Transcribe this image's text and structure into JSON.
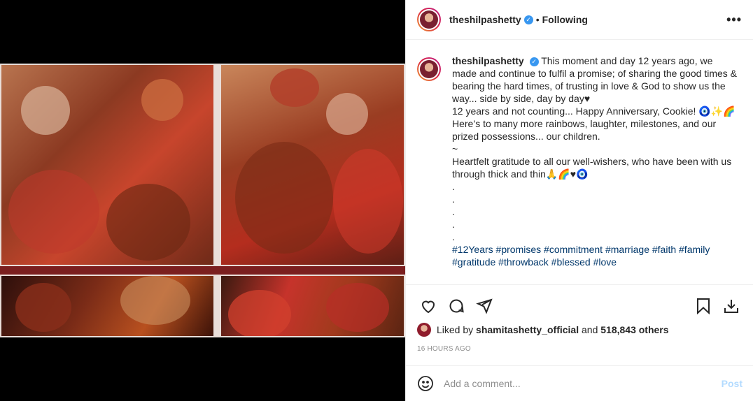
{
  "header": {
    "username": "theshilpashetty",
    "separator": "•",
    "follow_status": "Following",
    "more_label": "•••",
    "verified_mark": "✓"
  },
  "caption": {
    "username": "theshilpashetty",
    "lines": [
      "This moment and day 12 years ago, we made and continue to fulfil a promise; of sharing the good times & bearing the hard times, of trusting in love & God to show us the way... side by side, day by day♥",
      "12 years and not counting... Happy Anniversary, Cookie! 🧿✨🌈",
      "Here’s to many more rainbows, laughter, milestones, and our prized possessions... our children.",
      "~",
      "Heartfelt gratitude to all our well-wishers, who have been with us through thick and thin🙏🌈♥🧿",
      ".",
      ".",
      ".",
      ".",
      "."
    ],
    "hashtags": [
      "#12Years",
      "#promises",
      "#commitment",
      "#marriage",
      "#faith",
      "#family",
      "#gratitude",
      "#throwback",
      "#blessed",
      "#love"
    ]
  },
  "actions": {
    "icons": [
      "heart-icon",
      "comment-icon",
      "share-icon",
      "bookmark-icon",
      "download-icon"
    ]
  },
  "likes": {
    "prefix": "Liked by",
    "user": "shamitashetty_official",
    "and": "and",
    "count": "518,843 others"
  },
  "timestamp": "16 HOURS AGO",
  "comment_box": {
    "placeholder": "Add a comment...",
    "post_label": "Post"
  },
  "colors": {
    "link": "#00376b",
    "verified": "#3897f0",
    "post_disabled": "#b3dbff",
    "muted": "#8e8e8e"
  }
}
